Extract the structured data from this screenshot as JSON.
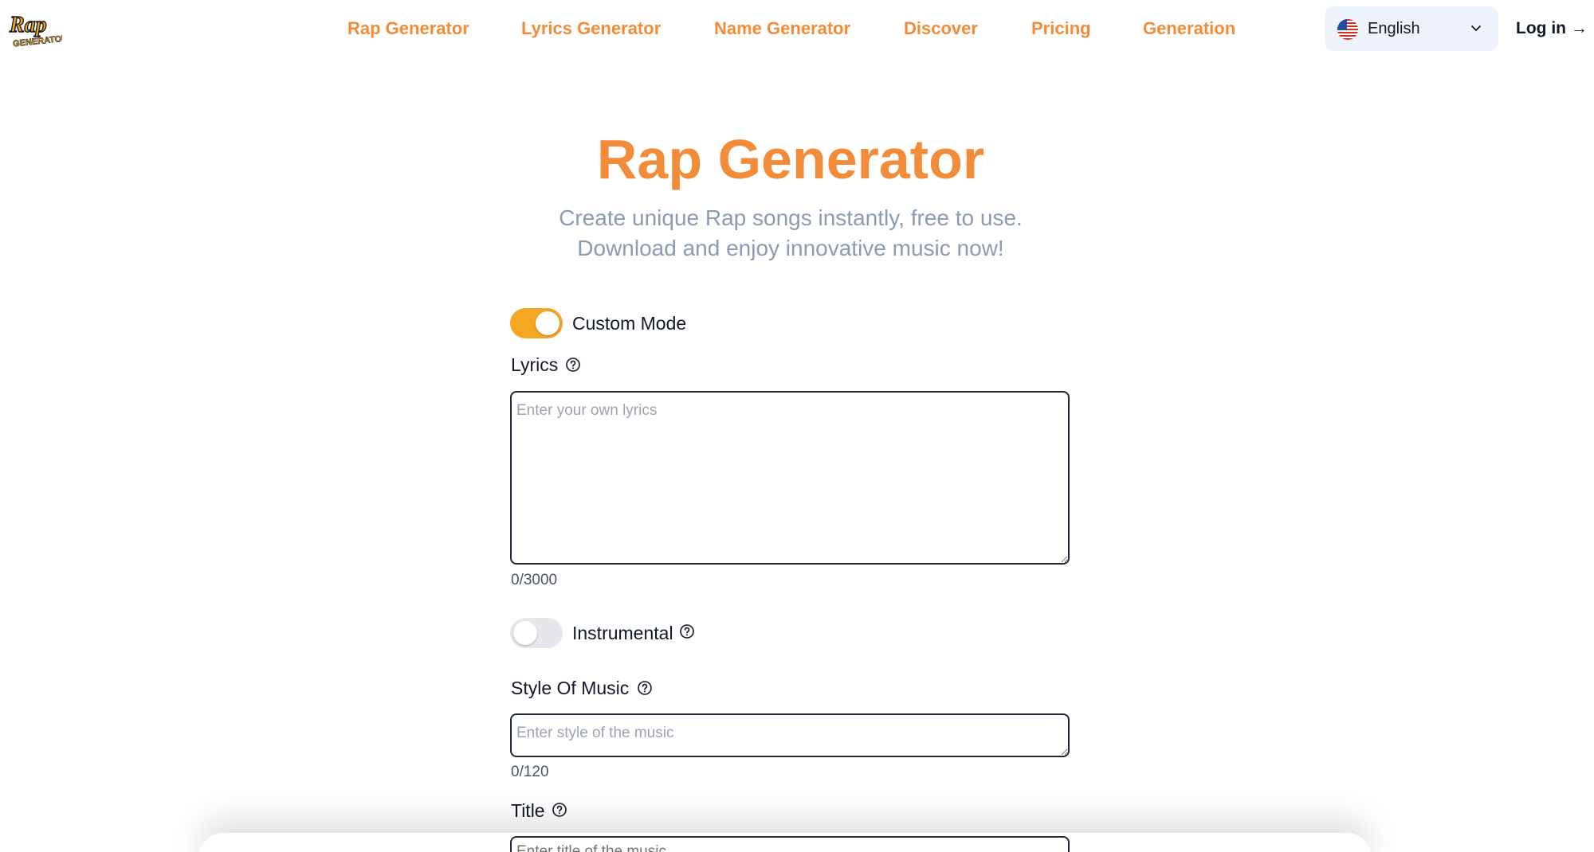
{
  "brand": {
    "logo_text": "Rap Generator",
    "accent_color": "#f28c38"
  },
  "nav": {
    "items": [
      {
        "label": "Rap Generator"
      },
      {
        "label": "Lyrics Generator"
      },
      {
        "label": "Name Generator"
      },
      {
        "label": "Discover"
      },
      {
        "label": "Pricing"
      },
      {
        "label": "Generation"
      }
    ],
    "language": {
      "selected": "English",
      "flag_icon": "us-flag-icon"
    },
    "login_label": "Log in →"
  },
  "hero": {
    "title": "Rap Generator",
    "subtitle_line1": "Create unique Rap songs instantly, free to use.",
    "subtitle_line2": "Download and enjoy innovative music now!"
  },
  "form": {
    "custom_mode": {
      "label": "Custom Mode",
      "enabled": true
    },
    "lyrics": {
      "label": "Lyrics",
      "placeholder": "Enter your own lyrics",
      "counter": "0/3000"
    },
    "instrumental": {
      "label": "Instrumental",
      "enabled": false
    },
    "style": {
      "label": "Style Of Music",
      "placeholder": "Enter style of the music",
      "counter": "0/120"
    },
    "title": {
      "label": "Title",
      "placeholder": "Enter title of the music"
    }
  }
}
